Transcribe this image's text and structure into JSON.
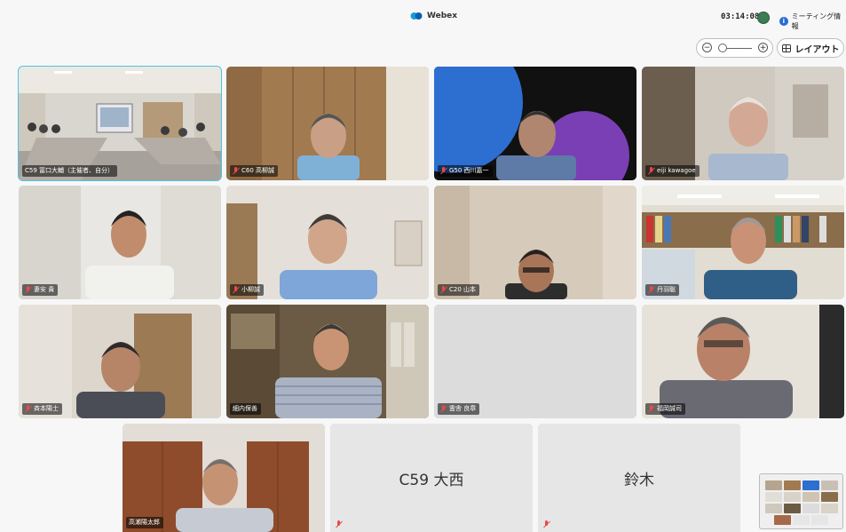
{
  "app": {
    "name": "Webex",
    "time": "03:14:08",
    "meeting_info": "ミーティング情報"
  },
  "toolbar": {
    "layout_label": "レイアウト",
    "zoom_out_glyph": "−",
    "zoom_in_glyph": "+"
  },
  "tiles": [
    {
      "name": "C59 冨口大輔（主催者、自分）"
    },
    {
      "name": "C60 高柳誠"
    },
    {
      "name": "G50 西川嘉一"
    },
    {
      "name": "eiji kawagoe"
    },
    {
      "name": "妻安 貴"
    },
    {
      "name": "小柳誠"
    },
    {
      "name": "C20 山本"
    },
    {
      "name": "丹羽聡"
    },
    {
      "name": "斉本陽士"
    },
    {
      "name": "細内保善"
    },
    {
      "name": "霊舎 良章"
    },
    {
      "name": "福岡誠司"
    },
    {
      "name": "高瀬陽太郎"
    },
    {
      "name": "C59 大西"
    },
    {
      "name": "鈴木"
    }
  ],
  "colors": {
    "active_border": "#4ec3e6",
    "recording": "#3b7c54",
    "muted": "#e84a4a",
    "info": "#2a6ad8"
  }
}
